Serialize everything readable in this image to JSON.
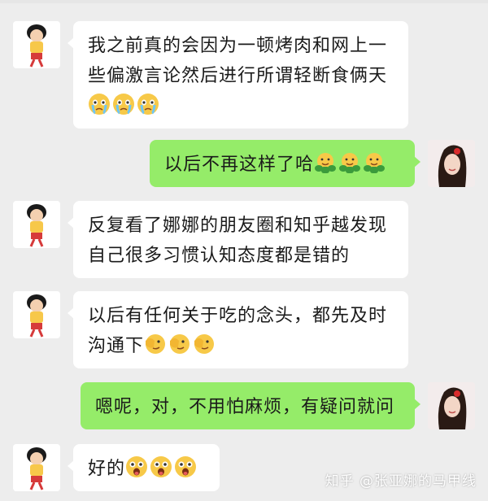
{
  "messages": [
    {
      "from": "left",
      "text": "我之前真的会因为一顿烤肉和网上一些偏激言论然后进行所谓轻断食俩天",
      "emojis": [
        "crying-face",
        "crying-face",
        "crying-face"
      ]
    },
    {
      "from": "right",
      "text": "以后不再这样了哈",
      "emojis": [
        "hug-face",
        "hug-face",
        "hug-face"
      ]
    },
    {
      "from": "left",
      "text": "反复看了娜娜的朋友圈和知乎越发现自己很多习惯认知态度都是错的",
      "emojis": []
    },
    {
      "from": "left",
      "text": "以后有任何关于吃的念头，都先及时沟通下",
      "emojis": [
        "facepalm-face",
        "facepalm-face",
        "facepalm-face"
      ]
    },
    {
      "from": "right",
      "text": "嗯呢，对，不用怕麻烦，有疑问就问",
      "emojis": []
    },
    {
      "from": "left",
      "text": "好的",
      "emojis": [
        "shocked-face",
        "shocked-face",
        "shocked-face"
      ]
    }
  ],
  "watermark": "知乎 @张亚娜的马甲线",
  "colors": {
    "background": "#ededed",
    "incoming_bubble": "#ffffff",
    "outgoing_bubble": "#95ec69"
  },
  "avatars": {
    "left": "cartoon-girl-avatar",
    "right": "woman-photo-avatar"
  }
}
